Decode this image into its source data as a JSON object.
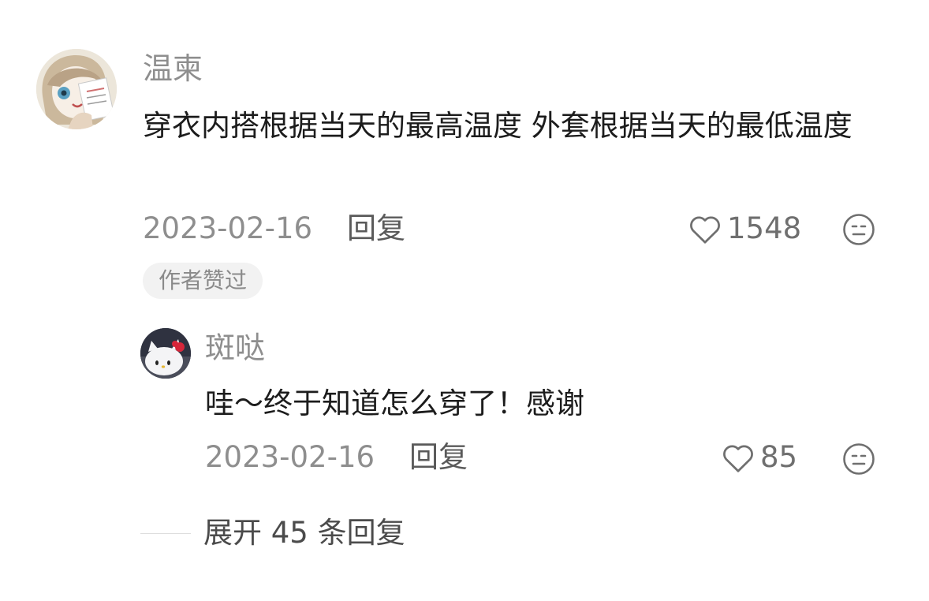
{
  "comment": {
    "username": "温柬",
    "text": "穿衣内搭根据当天的最高温度 外套根据当天的最低温度",
    "date": "2023-02-16",
    "reply_label": "回复",
    "like_count": "1548",
    "badge": "作者赞过"
  },
  "reply": {
    "username": "斑哒",
    "text": "哇～终于知道怎么穿了！感谢",
    "date": "2023-02-16",
    "reply_label": "回复",
    "like_count": "85"
  },
  "expand_label": "展开 45 条回复",
  "icons": {
    "like": "heart-outline-icon",
    "dislike": "meh-face-icon"
  },
  "colors": {
    "background": "#ffffff",
    "username": "#8e8e8e",
    "text": "#1c1c1c",
    "badge_bg": "#f2f2f2"
  }
}
